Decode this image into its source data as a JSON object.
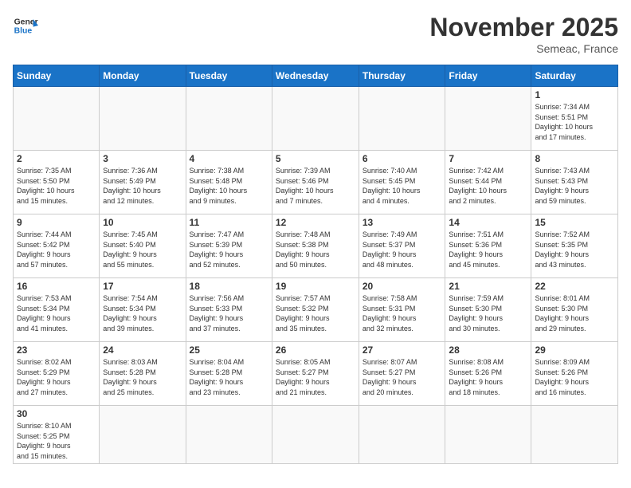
{
  "header": {
    "logo_general": "General",
    "logo_blue": "Blue",
    "month_title": "November 2025",
    "location": "Semeac, France"
  },
  "weekdays": [
    "Sunday",
    "Monday",
    "Tuesday",
    "Wednesday",
    "Thursday",
    "Friday",
    "Saturday"
  ],
  "days": {
    "d1": {
      "num": "1",
      "info": "Sunrise: 7:34 AM\nSunset: 5:51 PM\nDaylight: 10 hours\nand 17 minutes."
    },
    "d2": {
      "num": "2",
      "info": "Sunrise: 7:35 AM\nSunset: 5:50 PM\nDaylight: 10 hours\nand 15 minutes."
    },
    "d3": {
      "num": "3",
      "info": "Sunrise: 7:36 AM\nSunset: 5:49 PM\nDaylight: 10 hours\nand 12 minutes."
    },
    "d4": {
      "num": "4",
      "info": "Sunrise: 7:38 AM\nSunset: 5:48 PM\nDaylight: 10 hours\nand 9 minutes."
    },
    "d5": {
      "num": "5",
      "info": "Sunrise: 7:39 AM\nSunset: 5:46 PM\nDaylight: 10 hours\nand 7 minutes."
    },
    "d6": {
      "num": "6",
      "info": "Sunrise: 7:40 AM\nSunset: 5:45 PM\nDaylight: 10 hours\nand 4 minutes."
    },
    "d7": {
      "num": "7",
      "info": "Sunrise: 7:42 AM\nSunset: 5:44 PM\nDaylight: 10 hours\nand 2 minutes."
    },
    "d8": {
      "num": "8",
      "info": "Sunrise: 7:43 AM\nSunset: 5:43 PM\nDaylight: 9 hours\nand 59 minutes."
    },
    "d9": {
      "num": "9",
      "info": "Sunrise: 7:44 AM\nSunset: 5:42 PM\nDaylight: 9 hours\nand 57 minutes."
    },
    "d10": {
      "num": "10",
      "info": "Sunrise: 7:45 AM\nSunset: 5:40 PM\nDaylight: 9 hours\nand 55 minutes."
    },
    "d11": {
      "num": "11",
      "info": "Sunrise: 7:47 AM\nSunset: 5:39 PM\nDaylight: 9 hours\nand 52 minutes."
    },
    "d12": {
      "num": "12",
      "info": "Sunrise: 7:48 AM\nSunset: 5:38 PM\nDaylight: 9 hours\nand 50 minutes."
    },
    "d13": {
      "num": "13",
      "info": "Sunrise: 7:49 AM\nSunset: 5:37 PM\nDaylight: 9 hours\nand 48 minutes."
    },
    "d14": {
      "num": "14",
      "info": "Sunrise: 7:51 AM\nSunset: 5:36 PM\nDaylight: 9 hours\nand 45 minutes."
    },
    "d15": {
      "num": "15",
      "info": "Sunrise: 7:52 AM\nSunset: 5:35 PM\nDaylight: 9 hours\nand 43 minutes."
    },
    "d16": {
      "num": "16",
      "info": "Sunrise: 7:53 AM\nSunset: 5:34 PM\nDaylight: 9 hours\nand 41 minutes."
    },
    "d17": {
      "num": "17",
      "info": "Sunrise: 7:54 AM\nSunset: 5:34 PM\nDaylight: 9 hours\nand 39 minutes."
    },
    "d18": {
      "num": "18",
      "info": "Sunrise: 7:56 AM\nSunset: 5:33 PM\nDaylight: 9 hours\nand 37 minutes."
    },
    "d19": {
      "num": "19",
      "info": "Sunrise: 7:57 AM\nSunset: 5:32 PM\nDaylight: 9 hours\nand 35 minutes."
    },
    "d20": {
      "num": "20",
      "info": "Sunrise: 7:58 AM\nSunset: 5:31 PM\nDaylight: 9 hours\nand 32 minutes."
    },
    "d21": {
      "num": "21",
      "info": "Sunrise: 7:59 AM\nSunset: 5:30 PM\nDaylight: 9 hours\nand 30 minutes."
    },
    "d22": {
      "num": "22",
      "info": "Sunrise: 8:01 AM\nSunset: 5:30 PM\nDaylight: 9 hours\nand 29 minutes."
    },
    "d23": {
      "num": "23",
      "info": "Sunrise: 8:02 AM\nSunset: 5:29 PM\nDaylight: 9 hours\nand 27 minutes."
    },
    "d24": {
      "num": "24",
      "info": "Sunrise: 8:03 AM\nSunset: 5:28 PM\nDaylight: 9 hours\nand 25 minutes."
    },
    "d25": {
      "num": "25",
      "info": "Sunrise: 8:04 AM\nSunset: 5:28 PM\nDaylight: 9 hours\nand 23 minutes."
    },
    "d26": {
      "num": "26",
      "info": "Sunrise: 8:05 AM\nSunset: 5:27 PM\nDaylight: 9 hours\nand 21 minutes."
    },
    "d27": {
      "num": "27",
      "info": "Sunrise: 8:07 AM\nSunset: 5:27 PM\nDaylight: 9 hours\nand 20 minutes."
    },
    "d28": {
      "num": "28",
      "info": "Sunrise: 8:08 AM\nSunset: 5:26 PM\nDaylight: 9 hours\nand 18 minutes."
    },
    "d29": {
      "num": "29",
      "info": "Sunrise: 8:09 AM\nSunset: 5:26 PM\nDaylight: 9 hours\nand 16 minutes."
    },
    "d30": {
      "num": "30",
      "info": "Sunrise: 8:10 AM\nSunset: 5:25 PM\nDaylight: 9 hours\nand 15 minutes."
    }
  }
}
